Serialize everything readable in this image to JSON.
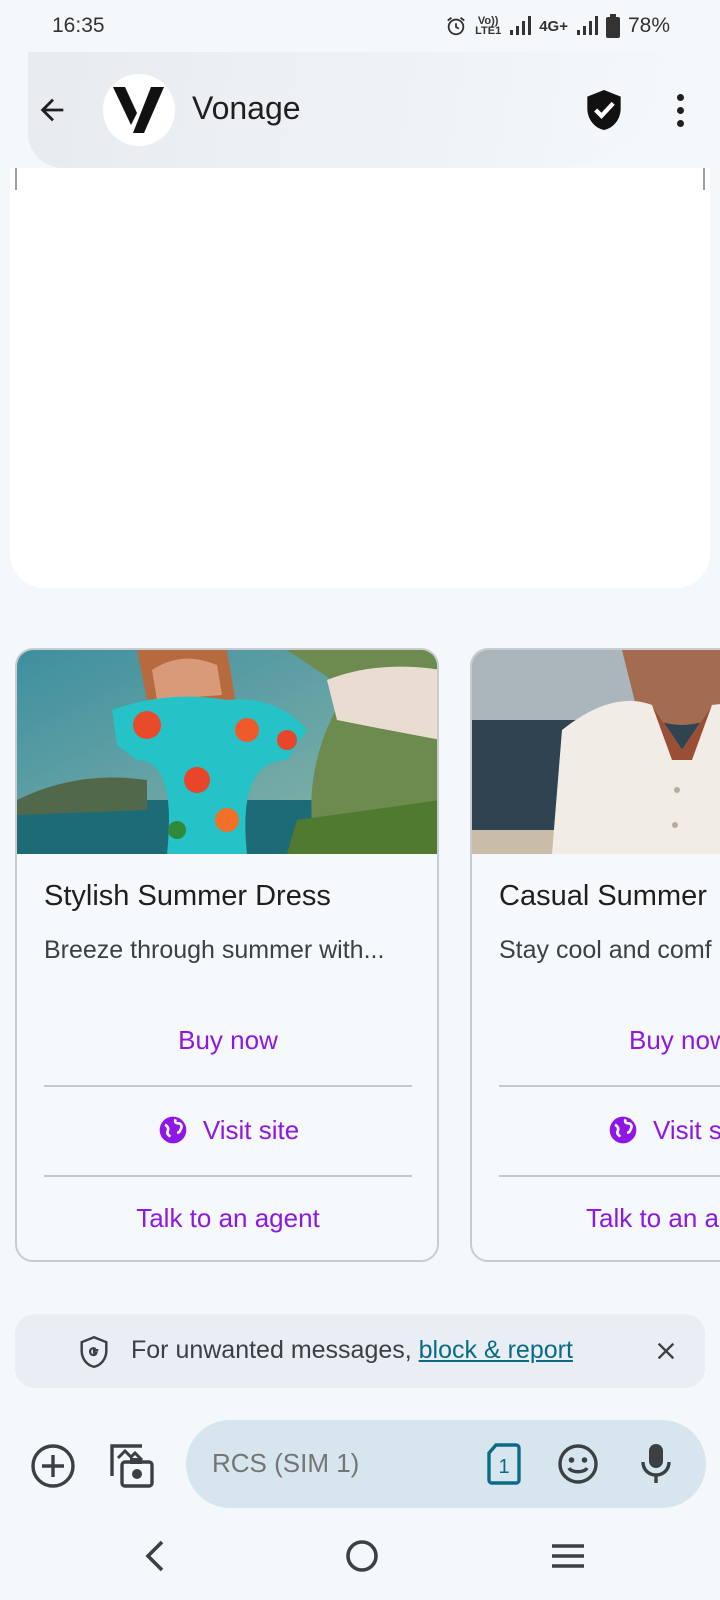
{
  "status_bar": {
    "time": "16:35",
    "volte": "Vo))",
    "lte": "LTE1",
    "network": "4G+",
    "battery": "78%"
  },
  "header": {
    "title": "Vonage",
    "avatar_letter": "V"
  },
  "carousel": {
    "cards": [
      {
        "title": "Stylish Summer Dress",
        "description": "Breeze through summer with...",
        "actions": [
          "Buy now",
          "Visit site",
          "Talk to an agent"
        ]
      },
      {
        "title": "Casual Summer",
        "description": "Stay cool and comf",
        "actions": [
          "Buy now",
          "Visit s",
          "Talk to an a"
        ]
      }
    ]
  },
  "spam_banner": {
    "text": "For unwanted messages, ",
    "link": "block & report"
  },
  "composer": {
    "placeholder": "RCS (SIM 1)",
    "sim_number": "1"
  },
  "colors": {
    "accent": "#8e17e6",
    "link": "#0b6b84",
    "background": "#f4f8fb",
    "composer_bg": "#d6e5ee"
  },
  "icons": [
    "back-arrow-icon",
    "verified-shield-icon",
    "more-vert-icon",
    "globe-icon",
    "shield-g-icon",
    "close-icon",
    "add-circle-icon",
    "gallery-icon",
    "sim-card-icon",
    "emoji-icon",
    "mic-icon",
    "nav-back-icon",
    "nav-home-icon",
    "nav-recents-icon"
  ]
}
